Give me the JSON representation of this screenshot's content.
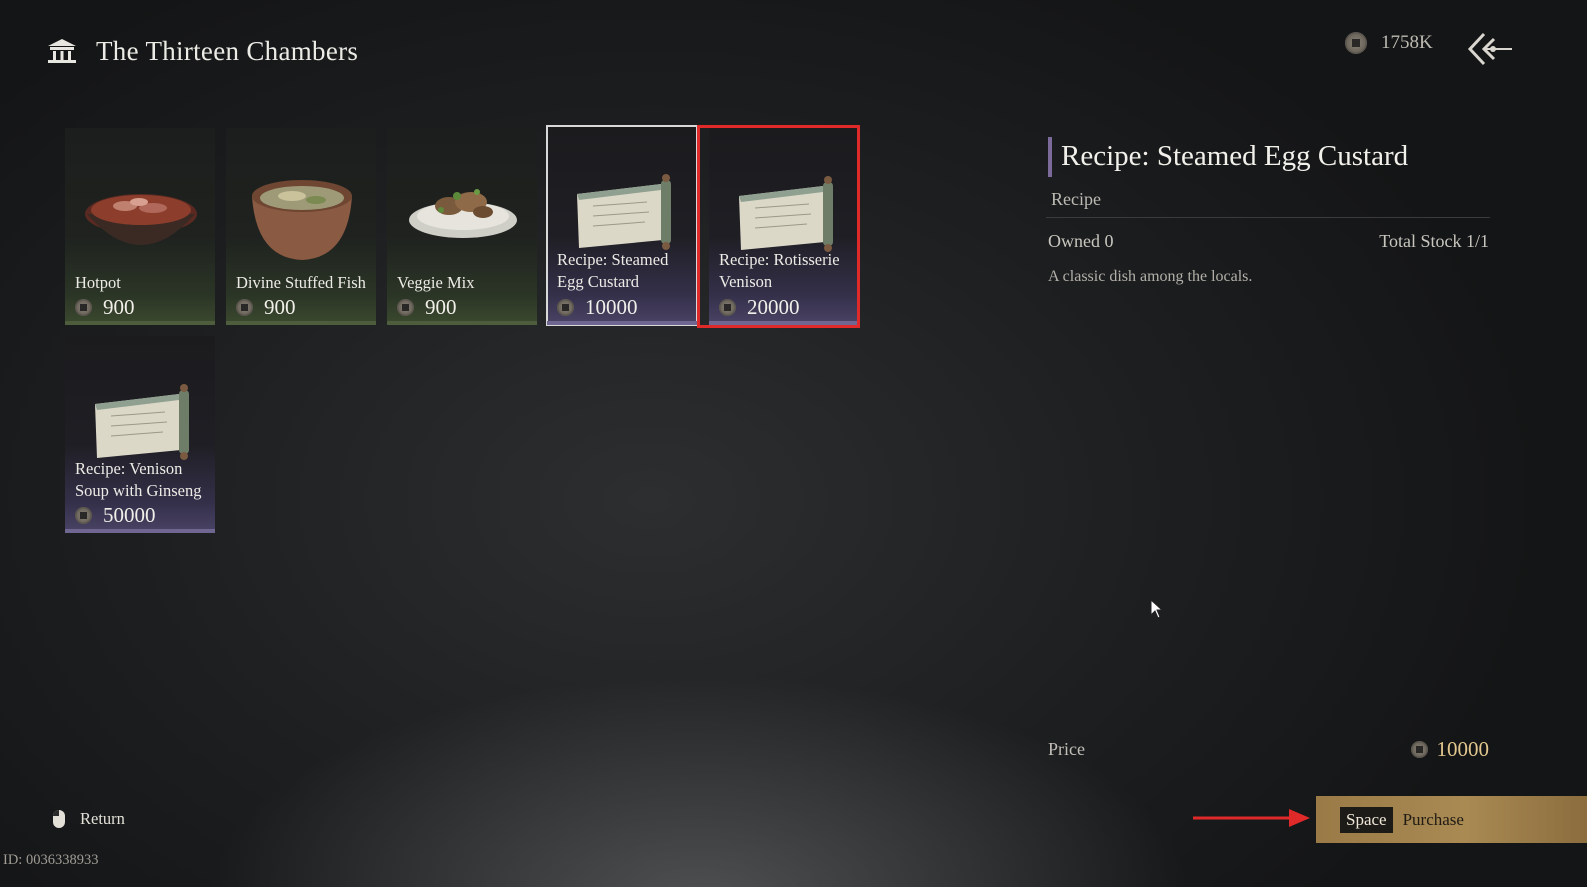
{
  "header": {
    "title": "The Thirteen Chambers",
    "currency_amount": "1758K"
  },
  "items": [
    {
      "name": "Hotpot",
      "price": "900",
      "kind": "food"
    },
    {
      "name": "Divine Stuffed Fish",
      "price": "900",
      "kind": "food"
    },
    {
      "name": "Veggie Mix",
      "price": "900",
      "kind": "food"
    },
    {
      "name": "Recipe: Steamed Egg Custard",
      "price": "10000",
      "kind": "recipe",
      "selected": true
    },
    {
      "name": "Recipe: Rotisserie Venison",
      "price": "20000",
      "kind": "recipe",
      "highlighted": true
    },
    {
      "name": "Recipe: Venison Soup with Ginseng",
      "price": "50000",
      "kind": "recipe"
    }
  ],
  "detail": {
    "title": "Recipe: Steamed Egg Custard",
    "type": "Recipe",
    "owned": "Owned 0",
    "stock": "Total Stock 1/1",
    "description": "A classic dish among the locals.",
    "price_label": "Price",
    "price_value": "10000"
  },
  "footer": {
    "return_label": "Return",
    "player_id": "ID: 0036338933",
    "key": "Space",
    "purchase_label": "Purchase"
  },
  "colors": {
    "accent_gold": "#a98a53",
    "annotation_red": "#e02a2a",
    "recipe_purple": "#6f6692",
    "food_green": "#4e5d3b"
  }
}
